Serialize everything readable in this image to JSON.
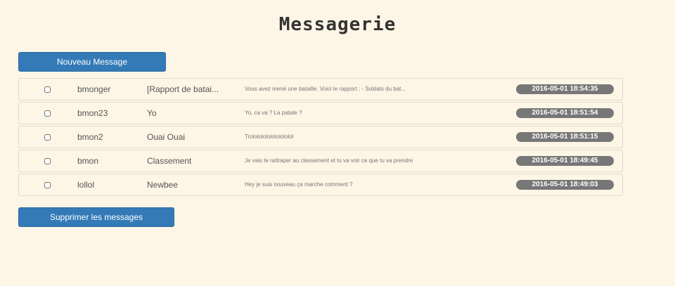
{
  "header": {
    "title": "Messagerie"
  },
  "toolbar": {
    "new_message_label": "Nouveau Message",
    "delete_messages_label": "Supprimer les messages"
  },
  "messages": [
    {
      "checked": false,
      "sender": "bmonger",
      "subject": "[Rapport de batai...",
      "preview": "Vous avez mené une bataille. Voici le rapport : - Soldats du bat...",
      "date": "2016-05-01 18:54:35"
    },
    {
      "checked": false,
      "sender": "bmon23",
      "subject": "Yo",
      "preview": "Yo, ca va ? La patate ?",
      "date": "2016-05-01 18:51:54"
    },
    {
      "checked": false,
      "sender": "bmon2",
      "subject": "Ouai Ouai",
      "preview": "Trolololololololololol",
      "date": "2016-05-01 18:51:15"
    },
    {
      "checked": false,
      "sender": "bmon",
      "subject": "Classement",
      "preview": "Je vais te rattraper au classement et tu va voir ce que tu va prendre",
      "date": "2016-05-01 18:49:45"
    },
    {
      "checked": false,
      "sender": "lollol",
      "subject": "Newbee",
      "preview": "Hey je suis nouveau ça marche comment ?",
      "date": "2016-05-01 18:49:03"
    }
  ],
  "colors": {
    "background": "#fdf5e6",
    "primary_button": "#337ab7",
    "date_badge": "#777777"
  }
}
